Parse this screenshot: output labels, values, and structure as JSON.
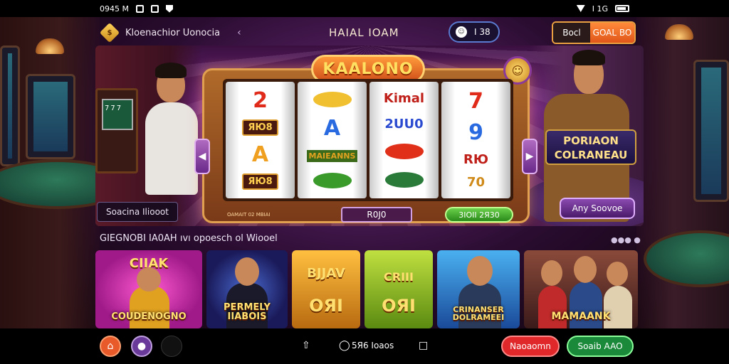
{
  "status_bar": {
    "time": "0945 M",
    "right_text": "I 1G"
  },
  "header": {
    "logo_letter": "$",
    "brand": "Kloenachior Uonocia",
    "back_icon": "chevron-left-icon",
    "title": "HAIAL IOAM",
    "coin_icon": "emoji-icon",
    "coin_value": "I 38",
    "button_left": "Bocl",
    "button_right": "GOAL BO"
  },
  "hero": {
    "slot_title": "KAALONO",
    "slot_badge_icon": "smiley-coin-icon",
    "reels": [
      [
        "2",
        "ЯЮ8",
        "A",
        "ЯЮ8"
      ],
      [
        "",
        "A",
        "MAIEANNS",
        ""
      ],
      [
        "Kimal",
        "2UU0",
        "",
        ""
      ],
      [
        "7",
        "9",
        "RЮ",
        "70"
      ]
    ],
    "slot_bottom_label": "OAMAIT 02 MBIAI",
    "slot_bet": "R0J0",
    "slot_spin": "3IOII 2Я30",
    "search_text": "Soacina Iliooot",
    "promo_title": "PORIAON COLRANEAU",
    "promo_button": "Any Soovoe"
  },
  "section": {
    "title": "GIEGNOBI IA0AH ıvı opoesch ol Wiooel",
    "more": "●●● ●"
  },
  "cards": [
    {
      "title": "COUDENOGNO",
      "sub": "CIIAK",
      "bg": "#c03aa0"
    },
    {
      "title": "PERMELY IIABOIS",
      "sub": "",
      "bg": "#1a2a6a"
    },
    {
      "title": "BJJAV",
      "sub": "ОЯI",
      "bg": "#d08a1a"
    },
    {
      "title": "CRIII",
      "sub": "ОЯI",
      "bg": "#8ab020"
    },
    {
      "title": "CRINANSER DOLRAMEEI",
      "sub": "",
      "bg": "#2a6ac0"
    },
    {
      "title": "MAMAANK",
      "sub": "",
      "bg": "#5a2a2a"
    }
  ],
  "bottom_bar": {
    "home_icon": "home-icon",
    "profile_icon": "profile-icon",
    "share_icon": "share-icon",
    "location_label": "5Я6 Ioaos",
    "tabs_icon": "tabs-icon",
    "btn_red": "Naoaomn",
    "btn_green": "Soaib AAO"
  }
}
